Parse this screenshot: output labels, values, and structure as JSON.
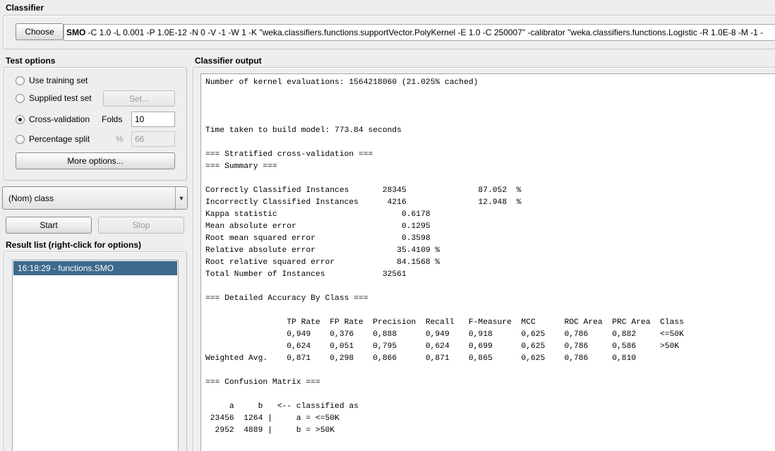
{
  "classifier": {
    "title": "Classifier",
    "choose_label": "Choose",
    "name": "SMO",
    "options": " -C 1.0 -L 0.001 -P 1.0E-12 -N 0 -V -1 -W 1 -K \"weka.classifiers.functions.supportVector.PolyKernel -E 1.0 -C 250007\" -calibrator \"weka.classifiers.functions.Logistic -R 1.0E-8 -M -1 -"
  },
  "test_options": {
    "title": "Test options",
    "selected": "Cross-validation",
    "use_training_set": "Use training set",
    "supplied_test_set": "Supplied test set",
    "set_label": "Set...",
    "cross_validation": "Cross-validation",
    "folds_label": "Folds",
    "folds_value": "10",
    "percentage_split": "Percentage split",
    "percent_symbol": "%",
    "percentage_value": "66",
    "more_options_label": "More options..."
  },
  "class_selector": {
    "value": "(Nom) class"
  },
  "actions": {
    "start_label": "Start",
    "stop_label": "Stop"
  },
  "result_list": {
    "title": "Result list (right-click for options)",
    "items": [
      "16:18:29 - functions.SMO"
    ]
  },
  "output": {
    "title": "Classifier output",
    "lines": [
      "Number of kernel evaluations: 1564218060 (21.025% cached)",
      "",
      "",
      "",
      "Time taken to build model: 773.84 seconds",
      "",
      "=== Stratified cross-validation ===",
      "=== Summary ===",
      "",
      "Correctly Classified Instances       28345               87.052  %",
      "Incorrectly Classified Instances      4216               12.948  %",
      "Kappa statistic                          0.6178",
      "Mean absolute error                      0.1295",
      "Root mean squared error                  0.3598",
      "Relative absolute error                 35.4109 %",
      "Root relative squared error             84.1568 %",
      "Total Number of Instances            32561",
      "",
      "=== Detailed Accuracy By Class ===",
      "",
      "                 TP Rate  FP Rate  Precision  Recall   F-Measure  MCC      ROC Area  PRC Area  Class",
      "                 0,949    0,376    0,888      0,949    0,918      0,625    0,786     0,882     <=50K",
      "                 0,624    0,051    0,795      0,624    0,699      0,625    0,786     0,586     >50K",
      "Weighted Avg.    0,871    0,298    0,866      0,871    0,865      0,625    0,786     0,810",
      "",
      "=== Confusion Matrix ===",
      "",
      "     a     b   <-- classified as",
      " 23456  1264 |     a = <=50K",
      "  2952  4889 |     b = >50K"
    ]
  }
}
